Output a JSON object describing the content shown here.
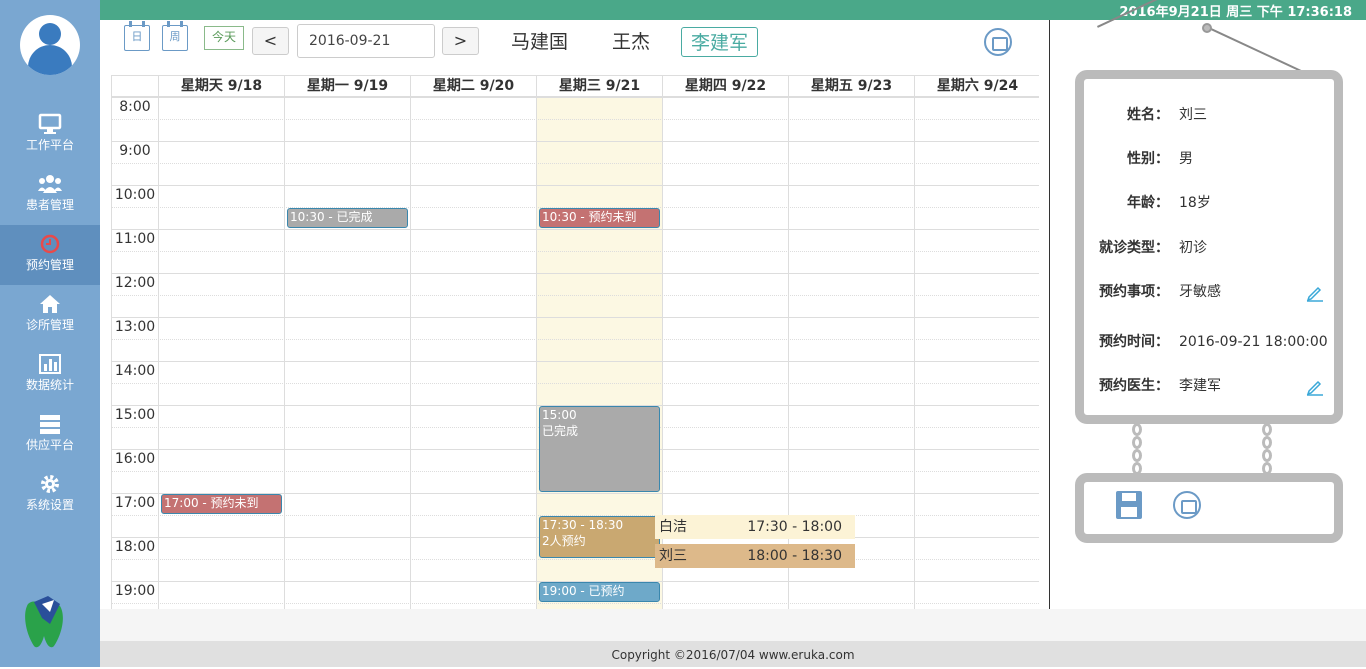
{
  "clock": "2016年9月21日 周三 下午 17:36:18",
  "nav": {
    "items": [
      {
        "label": "工作平台",
        "icon": "monitor-icon"
      },
      {
        "label": "患者管理",
        "icon": "users-icon"
      },
      {
        "label": "预约管理",
        "icon": "clock-icon"
      },
      {
        "label": "诊所管理",
        "icon": "home-icon"
      },
      {
        "label": "数据统计",
        "icon": "bar-chart-icon"
      },
      {
        "label": "供应平台",
        "icon": "server-icon"
      },
      {
        "label": "系统设置",
        "icon": "gear-icon"
      }
    ],
    "active_index": 2
  },
  "toolbar": {
    "day_label": "日",
    "week_label": "周",
    "today_label": "今天",
    "prev": "<",
    "next": ">",
    "date": "2016-09-21",
    "doctors": [
      "马建国",
      "王杰",
      "李建军"
    ],
    "active_doctor": 2
  },
  "calendar": {
    "days": [
      "星期天 9/18",
      "星期一 9/19",
      "星期二 9/20",
      "星期三 9/21",
      "星期四 9/22",
      "星期五 9/23",
      "星期六 9/24"
    ],
    "today_index": 3,
    "times": [
      "8:00",
      "9:00",
      "10:00",
      "11:00",
      "12:00",
      "13:00",
      "14:00",
      "15:00",
      "16:00",
      "17:00",
      "18:00",
      "19:00"
    ],
    "events": [
      {
        "day": 1,
        "start": "10:30",
        "end": "11:00",
        "text": "10:30 - 已完成",
        "status": "done"
      },
      {
        "day": 3,
        "start": "10:30",
        "end": "11:00",
        "text": "10:30 - 预约未到",
        "status": "miss"
      },
      {
        "day": 3,
        "start": "15:00",
        "end": "17:00",
        "text": "15:00\n已完成",
        "status": "done"
      },
      {
        "day": 0,
        "start": "17:00",
        "end": "17:30",
        "text": "17:00 - 预约未到",
        "status": "miss"
      },
      {
        "day": 3,
        "start": "17:30",
        "end": "18:30",
        "text": "17:30 - 18:30\n2人预约",
        "status": "multi"
      },
      {
        "day": 3,
        "start": "19:00",
        "end": "19:30",
        "text": "19:00 - 已预约",
        "status": "booked"
      }
    ],
    "popover": [
      {
        "name": "白洁",
        "time": "17:30 - 18:00"
      },
      {
        "name": "刘三",
        "time": "18:00 - 18:30"
      }
    ]
  },
  "patient": {
    "fields": [
      {
        "key": "姓名：",
        "value": "刘三",
        "editable": false
      },
      {
        "key": "性别：",
        "value": "男",
        "editable": false
      },
      {
        "key": "年龄：",
        "value": "18岁",
        "editable": false
      },
      {
        "key": "就诊类型：",
        "value": "初诊",
        "editable": false
      },
      {
        "key": "预约事项：",
        "value": "牙敏感",
        "editable": true
      },
      {
        "key": "预约时间：",
        "value": "2016-09-21 18:00:00",
        "editable": false
      },
      {
        "key": "预约医生：",
        "value": "李建军",
        "editable": true
      }
    ]
  },
  "colors": {
    "sidebar": "#7aa7d1",
    "topbar": "#4aa889",
    "today_bg": "#fcf8e3",
    "done": "#aaaaaa",
    "miss": "#c47272",
    "multi": "#c9a871",
    "booked": "#6ea9c9"
  },
  "footer": "Copyright ©2016/07/04 www.eruka.com"
}
